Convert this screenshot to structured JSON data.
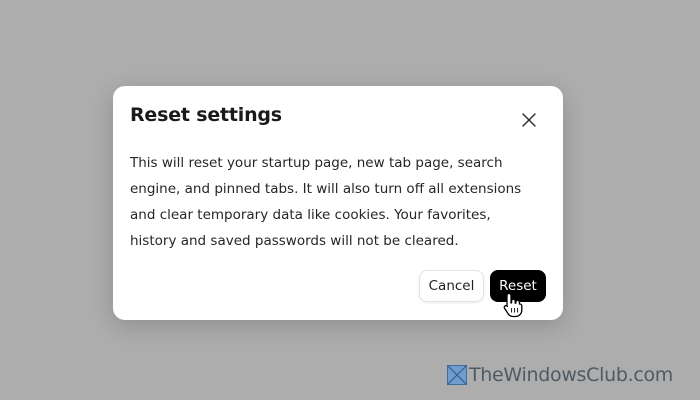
{
  "dialog": {
    "title": "Reset settings",
    "body": "This will reset your startup page, new tab page, search engine, and pinned tabs. It will also turn off all extensions and clear temporary data like cookies. Your favorites, history and saved passwords will not be cleared.",
    "close_icon": "close-icon",
    "cancel_label": "Cancel",
    "reset_label": "Reset"
  },
  "watermark": {
    "text": "TheWindowsClub.com"
  },
  "colors": {
    "overlay": "#adadad",
    "dialog_bg": "#ffffff",
    "primary_button": "#000000",
    "primary_text": "#ffffff",
    "watermark_text": "#4f5a63",
    "watermark_logo": "#4a7fb5"
  },
  "cursor": "hand-pointer-icon"
}
